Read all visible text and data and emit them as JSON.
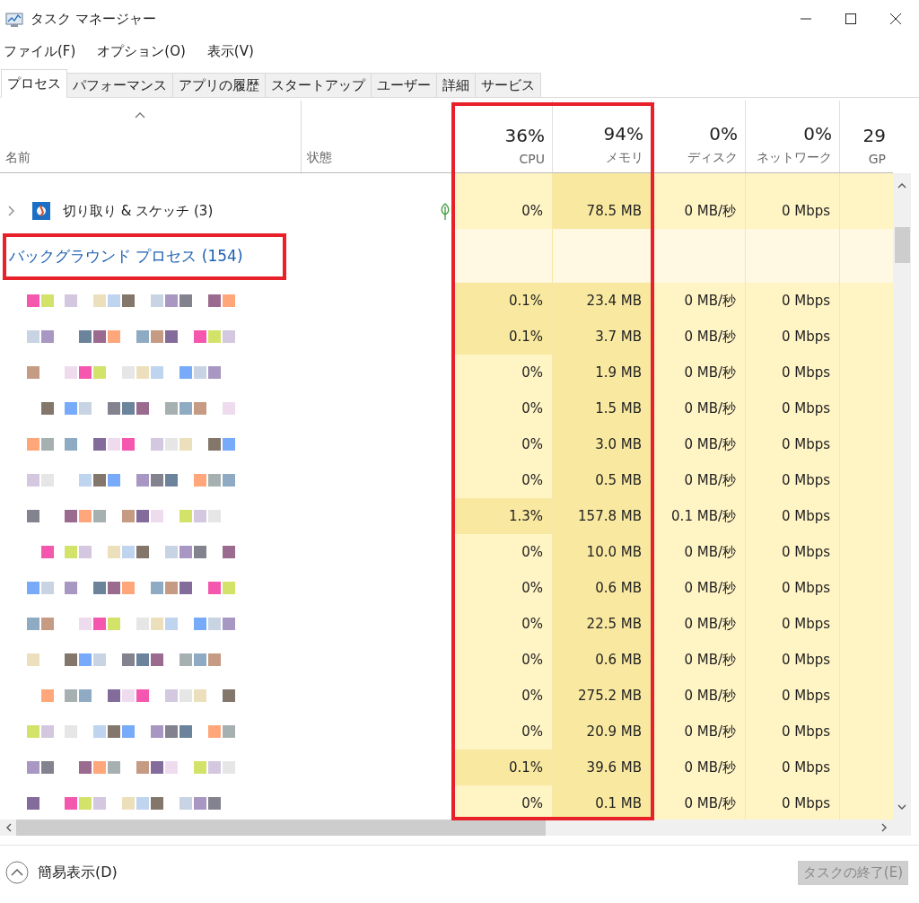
{
  "window": {
    "title": "タスク マネージャー"
  },
  "menu": [
    "ファイル(F)",
    "オプション(O)",
    "表示(V)"
  ],
  "tabs": [
    {
      "label": "プロセス",
      "selected": true
    },
    {
      "label": "パフォーマンス",
      "selected": false
    },
    {
      "label": "アプリの履歴",
      "selected": false
    },
    {
      "label": "スタートアップ",
      "selected": false
    },
    {
      "label": "ユーザー",
      "selected": false
    },
    {
      "label": "詳細",
      "selected": false
    },
    {
      "label": "サービス",
      "selected": false
    }
  ],
  "columns": [
    {
      "label": "名前"
    },
    {
      "label": "状態"
    },
    {
      "percent": "36%",
      "label": "CPU"
    },
    {
      "percent": "94%",
      "label": "メモリ"
    },
    {
      "percent": "0%",
      "label": "ディスク"
    },
    {
      "percent": "0%",
      "label": "ネットワーク"
    },
    {
      "percent": "29",
      "label": "GP"
    }
  ],
  "apps": [
    {
      "name": "切り取り & スケッチ (3)",
      "expanded": false,
      "efficiency_mode": true,
      "cpu": "0%",
      "memory": "78.5 MB",
      "disk": "0 MB/秒",
      "network": "0 Mbps"
    }
  ],
  "background_group": {
    "title": "バックグラウンド プロセス (154)",
    "rows": [
      {
        "cpu": "0.1%",
        "cpu_busy": true,
        "memory": "23.4 MB",
        "disk": "0 MB/秒",
        "network": "0 Mbps"
      },
      {
        "cpu": "0.1%",
        "cpu_busy": true,
        "memory": "3.7 MB",
        "disk": "0 MB/秒",
        "network": "0 Mbps"
      },
      {
        "cpu": "0%",
        "cpu_busy": false,
        "memory": "1.9 MB",
        "disk": "0 MB/秒",
        "network": "0 Mbps"
      },
      {
        "cpu": "0%",
        "cpu_busy": false,
        "memory": "1.5 MB",
        "disk": "0 MB/秒",
        "network": "0 Mbps"
      },
      {
        "cpu": "0%",
        "cpu_busy": false,
        "memory": "3.0 MB",
        "disk": "0 MB/秒",
        "network": "0 Mbps"
      },
      {
        "cpu": "0%",
        "cpu_busy": false,
        "memory": "0.5 MB",
        "disk": "0 MB/秒",
        "network": "0 Mbps"
      },
      {
        "cpu": "1.3%",
        "cpu_busy": true,
        "memory": "157.8 MB",
        "disk": "0.1 MB/秒",
        "network": "0 Mbps"
      },
      {
        "cpu": "0%",
        "cpu_busy": false,
        "memory": "10.0 MB",
        "disk": "0 MB/秒",
        "network": "0 Mbps"
      },
      {
        "cpu": "0%",
        "cpu_busy": false,
        "memory": "0.6 MB",
        "disk": "0 MB/秒",
        "network": "0 Mbps"
      },
      {
        "cpu": "0%",
        "cpu_busy": false,
        "memory": "22.5 MB",
        "disk": "0 MB/秒",
        "network": "0 Mbps"
      },
      {
        "cpu": "0%",
        "cpu_busy": false,
        "memory": "0.6 MB",
        "disk": "0 MB/秒",
        "network": "0 Mbps"
      },
      {
        "cpu": "0%",
        "cpu_busy": false,
        "memory": "275.2 MB",
        "disk": "0 MB/秒",
        "network": "0 Mbps"
      },
      {
        "cpu": "0%",
        "cpu_busy": false,
        "memory": "20.9 MB",
        "disk": "0 MB/秒",
        "network": "0 Mbps"
      },
      {
        "cpu": "0.1%",
        "cpu_busy": true,
        "memory": "39.6 MB",
        "disk": "0 MB/秒",
        "network": "0 Mbps"
      },
      {
        "cpu": "0%",
        "cpu_busy": false,
        "memory": "0.1 MB",
        "disk": "0 MB/秒",
        "network": "0 Mbps"
      }
    ]
  },
  "footer": {
    "toggle": "簡易表示(D)",
    "end_task": {
      "label": "タスクの終了(E)",
      "disabled": true
    }
  }
}
